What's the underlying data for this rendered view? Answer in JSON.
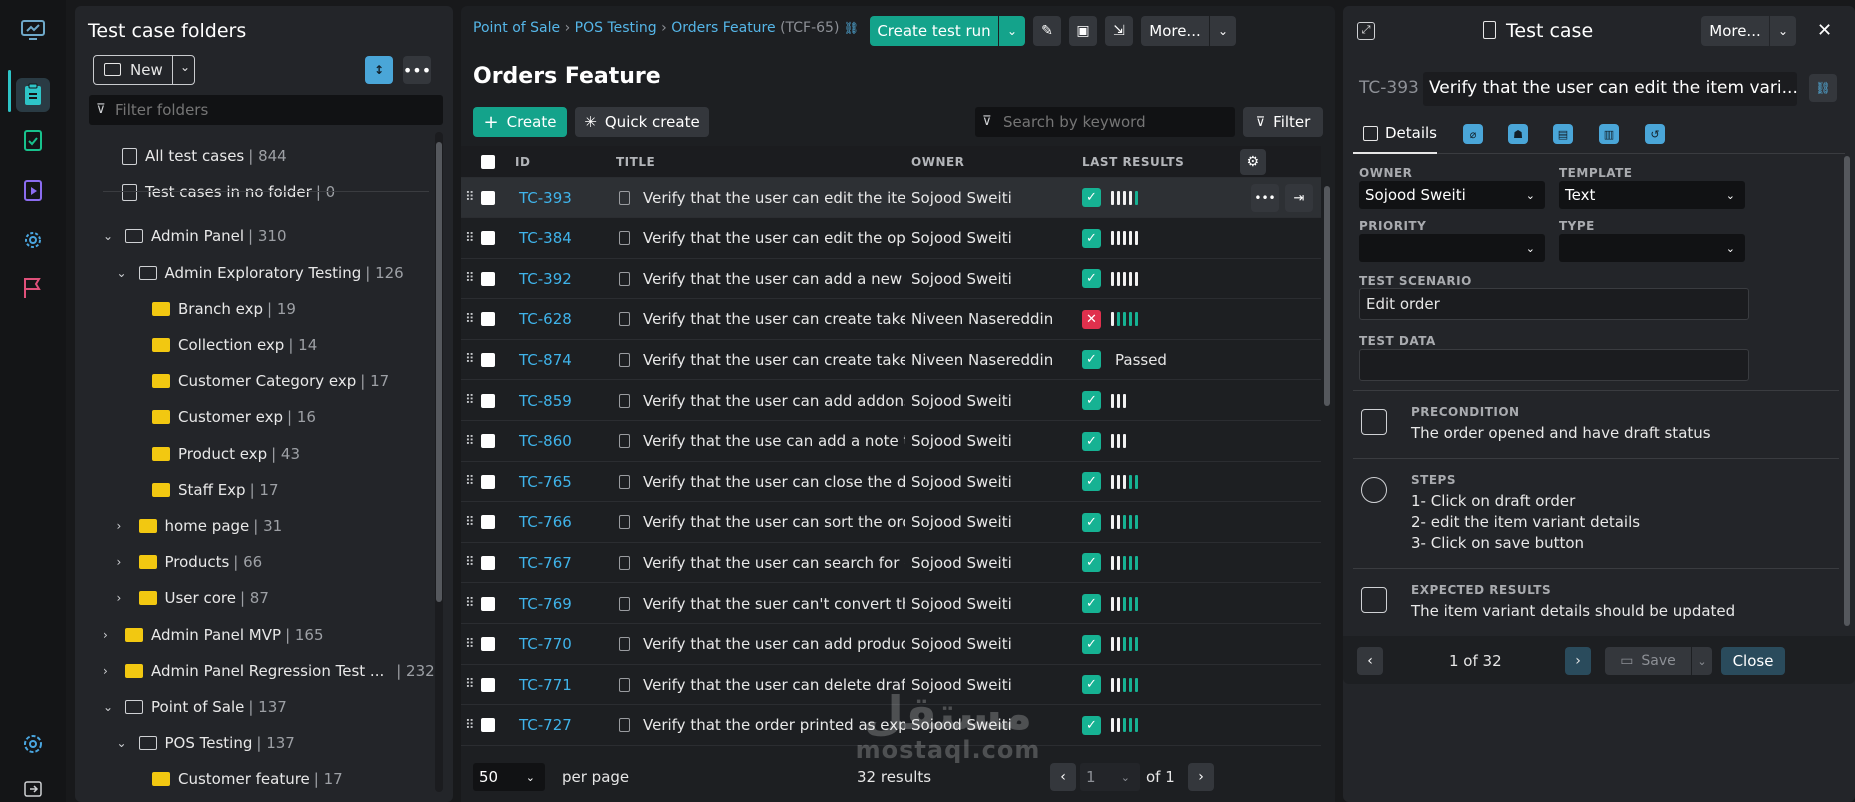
{
  "folders_panel": {
    "title": "Test case folders",
    "new_label": "New",
    "filter_placeholder": "Filter folders",
    "items": [
      {
        "label": "All test cases",
        "count": "844",
        "level": 0,
        "type": "all"
      },
      {
        "label": "Test cases in no folder",
        "count": "0",
        "level": 0,
        "type": "none"
      },
      {
        "label": "Admin Panel",
        "count": "310",
        "level": 0,
        "type": "open",
        "chev": "v"
      },
      {
        "label": "Admin Exploratory Testing",
        "count": "126",
        "level": 1,
        "type": "open",
        "chev": "v"
      },
      {
        "label": "Branch exp",
        "count": "19",
        "level": 2,
        "type": "folder"
      },
      {
        "label": "Collection exp",
        "count": "14",
        "level": 2,
        "type": "folder"
      },
      {
        "label": "Customer Category exp",
        "count": "17",
        "level": 2,
        "type": "folder"
      },
      {
        "label": "Customer exp",
        "count": "16",
        "level": 2,
        "type": "folder"
      },
      {
        "label": "Product exp",
        "count": "43",
        "level": 2,
        "type": "folder"
      },
      {
        "label": "Staff Exp",
        "count": "17",
        "level": 2,
        "type": "folder"
      },
      {
        "label": "home page",
        "count": "31",
        "level": 1,
        "type": "folder",
        "chev": ">"
      },
      {
        "label": "Products",
        "count": "66",
        "level": 1,
        "type": "folder",
        "chev": ">"
      },
      {
        "label": "User core",
        "count": "87",
        "level": 1,
        "type": "folder",
        "chev": ">"
      },
      {
        "label": "Admin Panel MVP",
        "count": "165",
        "level": 0,
        "type": "folder",
        "chev": ">"
      },
      {
        "label": "Admin Panel Regression Test ...",
        "count": "232",
        "level": 0,
        "type": "folder",
        "chev": ">"
      },
      {
        "label": "Point of Sale",
        "count": "137",
        "level": 0,
        "type": "open",
        "chev": "v"
      },
      {
        "label": "POS Testing",
        "count": "137",
        "level": 1,
        "type": "open",
        "chev": "v"
      },
      {
        "label": "Customer feature",
        "count": "17",
        "level": 2,
        "type": "folder"
      }
    ]
  },
  "main": {
    "breadcrumb": {
      "a": "Point of Sale",
      "b": "POS Testing",
      "c": "Orders Feature",
      "code": "(TCF-65)"
    },
    "create_run_label": "Create test run",
    "more_label": "More...",
    "title": "Orders Feature",
    "create_label": "Create",
    "quick_create_label": "Quick create",
    "search_placeholder": "Search by keyword",
    "filter_label": "Filter",
    "columns": {
      "id": "ID",
      "title": "TITLE",
      "owner": "OWNER",
      "last": "LAST RESULTS"
    },
    "rows": [
      {
        "id": "TC-393",
        "title": "Verify that the user can edit the item variant details",
        "owner": "Sojood Sweiti",
        "status": "pass",
        "bars": "wwwwg"
      },
      {
        "id": "TC-384",
        "title": "Verify that the user can edit the opened order",
        "owner": "Sojood Sweiti",
        "status": "pass",
        "bars": "wwwww"
      },
      {
        "id": "TC-392",
        "title": "Verify that the user can add a new item to order",
        "owner": "Sojood Sweiti",
        "status": "pass",
        "bars": "wwwww"
      },
      {
        "id": "TC-628",
        "title": "Verify that the user can create takeaway order",
        "owner": "Niveen Nasereddin",
        "status": "fail",
        "bars": "wgggg"
      },
      {
        "id": "TC-874",
        "title": "Verify that the user can create takeaway order with note",
        "owner": "Niveen Nasereddin",
        "status": "pass",
        "text": "Passed"
      },
      {
        "id": "TC-859",
        "title": "Verify that the user can add addons to items",
        "owner": "Sojood Sweiti",
        "status": "pass",
        "bars": "www"
      },
      {
        "id": "TC-860",
        "title": "Verify that the use can add a note to the order",
        "owner": "Sojood Sweiti",
        "status": "pass",
        "bars": "www"
      },
      {
        "id": "TC-765",
        "title": "Verify that the user can close the day",
        "owner": "Sojood Sweiti",
        "status": "pass",
        "bars": "wwwgg"
      },
      {
        "id": "TC-766",
        "title": "Verify that the user can sort the orders",
        "owner": "Sojood Sweiti",
        "status": "pass",
        "bars": "wwggg"
      },
      {
        "id": "TC-767",
        "title": "Verify that the user can search for orders",
        "owner": "Sojood Sweiti",
        "status": "pass",
        "bars": "wwggg"
      },
      {
        "id": "TC-769",
        "title": "Verify that the suer can't convert the order",
        "owner": "Sojood Sweiti",
        "status": "pass",
        "bars": "wwggg"
      },
      {
        "id": "TC-770",
        "title": "Verify that the user can add products to order",
        "owner": "Sojood Sweiti",
        "status": "pass",
        "bars": "wwggg"
      },
      {
        "id": "TC-771",
        "title": "Verify that the user can delete draft orders",
        "owner": "Sojood Sweiti",
        "status": "pass",
        "bars": "wwggg"
      },
      {
        "id": "TC-727",
        "title": "Verify that the order printed as expected",
        "owner": "Sojood Sweiti",
        "status": "pass",
        "bars": "wwggg"
      }
    ],
    "per_page": "50",
    "per_page_label": "per page",
    "results": "32 results",
    "page": "1",
    "of_pages": "of 1"
  },
  "detail": {
    "header": "Test case",
    "more_label": "More...",
    "key": "TC-393",
    "title": "Verify that the user can edit the item vari...",
    "tab_details": "Details",
    "owner_label": "OWNER",
    "owner": "Sojood Sweiti",
    "template_label": "TEMPLATE",
    "template": "Text",
    "priority_label": "PRIORITY",
    "priority": "",
    "type_label": "TYPE",
    "type": "",
    "scenario_label": "TEST SCENARIO",
    "scenario": "Edit order",
    "data_label": "TEST DATA",
    "data": "",
    "pre_label": "PRECONDITION",
    "pre": "The order opened and have draft status",
    "steps_label": "STEPS",
    "steps": [
      "1- Click on draft order",
      "2- edit the item variant details",
      "3- Click on save button"
    ],
    "exp_label": "EXPECTED RESULTS",
    "exp": "The item variant details should be updated",
    "pager": "1 of 32",
    "save_label": "Save",
    "close_label": "Close"
  },
  "watermark": {
    "ar": "مستقل",
    "en": "mostaql.com"
  }
}
